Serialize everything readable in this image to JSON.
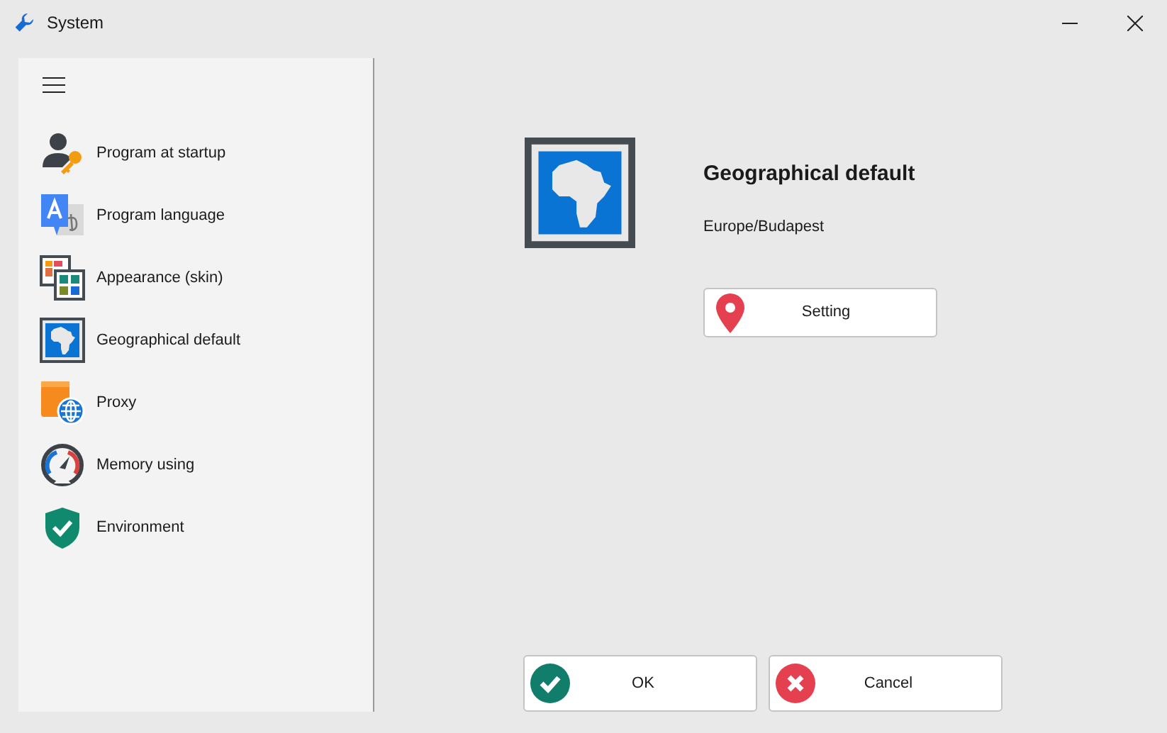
{
  "window": {
    "title": "System"
  },
  "sidebar": {
    "items": [
      {
        "kind": "startup",
        "label": "Program at startup"
      },
      {
        "kind": "language",
        "label": "Program language"
      },
      {
        "kind": "skin",
        "label": "Appearance (skin)"
      },
      {
        "kind": "geo",
        "label": "Geographical default"
      },
      {
        "kind": "proxy",
        "label": "Proxy"
      },
      {
        "kind": "memory",
        "label": "Memory using"
      },
      {
        "kind": "environment",
        "label": "Environment"
      }
    ]
  },
  "panel": {
    "title": "Geographical default",
    "value": "Europe/Budapest",
    "setting_button": "Setting"
  },
  "buttons": [
    {
      "kind": "ok",
      "label": "OK"
    },
    {
      "kind": "cancel",
      "label": "Cancel"
    }
  ]
}
